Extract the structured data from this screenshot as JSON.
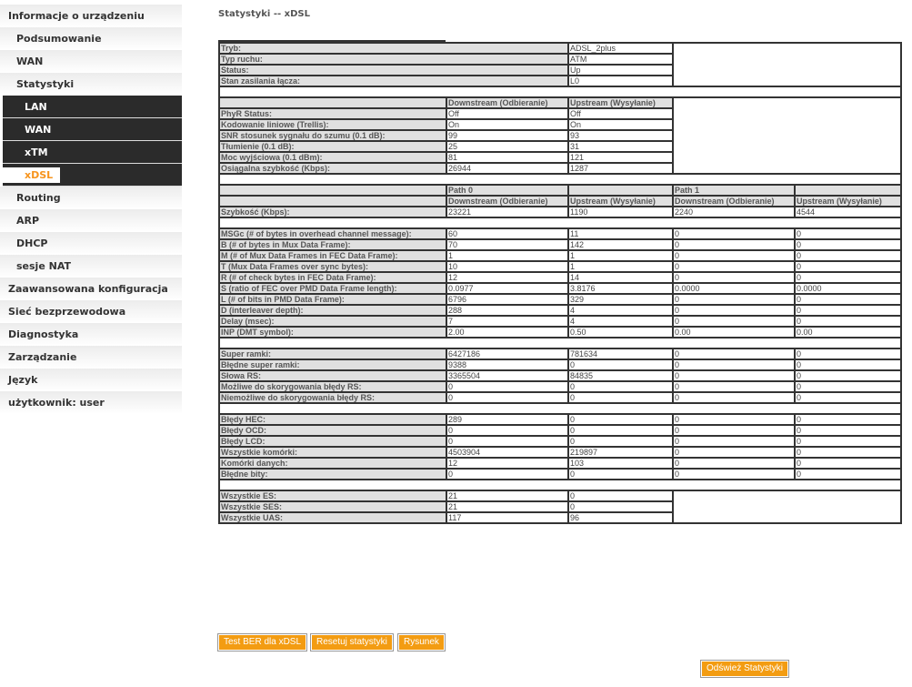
{
  "sidebar": {
    "items": [
      {
        "label": "Informacje o urządzeniu",
        "level": 0
      },
      {
        "label": "Podsumowanie",
        "level": 1
      },
      {
        "label": "WAN",
        "level": 1
      },
      {
        "label": "Statystyki",
        "level": 1
      },
      {
        "label": "LAN",
        "level": 2
      },
      {
        "label": "WAN",
        "level": 2
      },
      {
        "label": "xTM",
        "level": 2
      },
      {
        "label": "xDSL",
        "level": 2,
        "active": true
      },
      {
        "label": "Routing",
        "level": 1
      },
      {
        "label": "ARP",
        "level": 1
      },
      {
        "label": "DHCP",
        "level": 1
      },
      {
        "label": "sesje NAT",
        "level": 1
      },
      {
        "label": "Zaawansowana konfiguracja",
        "level": 0
      },
      {
        "label": "Sieć bezprzewodowa",
        "level": 0
      },
      {
        "label": "Diagnostyka",
        "level": 0
      },
      {
        "label": "Zarządzanie",
        "level": 0
      },
      {
        "label": "Język",
        "level": 0
      },
      {
        "label": "użytkownik: user",
        "level": 0
      }
    ]
  },
  "page_title": "Statystyki -- xDSL",
  "accent_color": "#f39c12",
  "general": [
    [
      "Tryb:",
      "ADSL_2plus"
    ],
    [
      "Typ ruchu:",
      "ATM"
    ],
    [
      "Status:",
      "Up"
    ],
    [
      "Stan zasilania łącza:",
      "L0"
    ]
  ],
  "line_headers": [
    "Downstream (Odbieranie)",
    "Upstream (Wysyłanie)"
  ],
  "line": [
    [
      "PhyR Status:",
      "Off",
      "Off"
    ],
    [
      "Kodowanie liniowe (Trellis):",
      "On",
      "On"
    ],
    [
      "SNR stosunek sygnału do szumu (0.1 dB):",
      "99",
      "93"
    ],
    [
      "Tłumienie (0.1 dB):",
      "25",
      "31"
    ],
    [
      "Moc wyjściowa (0.1 dBm):",
      "81",
      "121"
    ],
    [
      "Osiągalna szybkość (Kbps):",
      "26944",
      "1287"
    ]
  ],
  "path_headers": [
    "Path 0",
    "",
    "Path 1",
    ""
  ],
  "path_sub_headers": [
    "Downstream (Odbieranie)",
    "Upstream (Wysyłanie)",
    "Downstream (Odbieranie)",
    "Upstream (Wysyłanie)"
  ],
  "rate": [
    [
      "Szybkość (Kbps):",
      "23221",
      "1190",
      "2240",
      "4544"
    ]
  ],
  "framing": [
    [
      "MSGc (# of bytes in overhead channel message):",
      "60",
      "11",
      "0",
      "0"
    ],
    [
      "B (# of bytes in Mux Data Frame):",
      "70",
      "142",
      "0",
      "0"
    ],
    [
      "M (# of Mux Data Frames in FEC Data Frame):",
      "1",
      "1",
      "0",
      "0"
    ],
    [
      "T (Mux Data Frames over sync bytes):",
      "10",
      "1",
      "0",
      "0"
    ],
    [
      "R (# of check bytes in FEC Data Frame):",
      "12",
      "14",
      "0",
      "0"
    ],
    [
      "S (ratio of FEC over PMD Data Frame length):",
      "0.0977",
      "3.8176",
      "0.0000",
      "0.0000"
    ],
    [
      "L (# of bits in PMD Data Frame):",
      "6796",
      "329",
      "0",
      "0"
    ],
    [
      "D (interleaver depth):",
      "288",
      "4",
      "0",
      "0"
    ],
    [
      "Delay (msec):",
      "7",
      "4",
      "0",
      "0"
    ],
    [
      "INP (DMT symbol):",
      "2.00",
      "0.50",
      "0.00",
      "0.00"
    ]
  ],
  "frames": [
    [
      "Super ramki:",
      "6427186",
      "781634",
      "0",
      "0"
    ],
    [
      "Błędne super ramki:",
      "9388",
      "0",
      "0",
      "0"
    ],
    [
      "Słowa RS:",
      "3365504",
      "84835",
      "0",
      "0"
    ],
    [
      "Możliwe do skorygowania błędy RS:",
      "0",
      "0",
      "0",
      "0"
    ],
    [
      "Niemożliwe do skorygowania błędy RS:",
      "0",
      "0",
      "0",
      "0"
    ]
  ],
  "cells": [
    [
      "Błędy HEC:",
      "289",
      "0",
      "0",
      "0"
    ],
    [
      "Błędy OCD:",
      "0",
      "0",
      "0",
      "0"
    ],
    [
      "Błędy LCD:",
      "0",
      "0",
      "0",
      "0"
    ],
    [
      "Wszystkie komórki:",
      "4503904",
      "219897",
      "0",
      "0"
    ],
    [
      "Komórki danych:",
      "12",
      "103",
      "0",
      "0"
    ],
    [
      "Błędne bity:",
      "0",
      "0",
      "0",
      "0"
    ]
  ],
  "seconds": [
    [
      "Wszystkie ES:",
      "21",
      "0"
    ],
    [
      "Wszystkie SES:",
      "21",
      "0"
    ],
    [
      "Wszystkie UAS:",
      "117",
      "96"
    ]
  ],
  "buttons": {
    "ber": "Test BER dla xDSL",
    "reset": "Resetuj statystyki",
    "graph": "Rysunek",
    "refresh": "Odśwież Statystyki"
  }
}
